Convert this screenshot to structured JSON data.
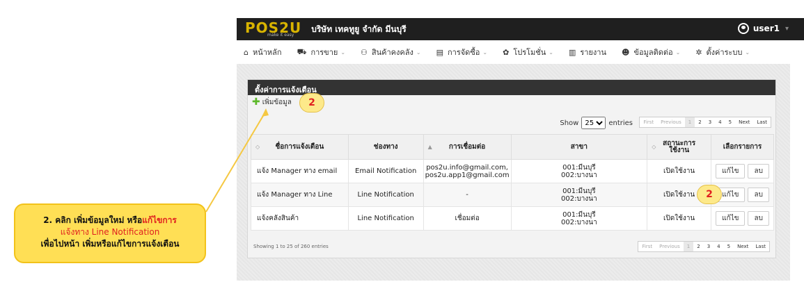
{
  "header": {
    "logo": "POS2U",
    "logo_tagline": "make it easy",
    "company": "บริษัท เทคทูยู จำกัด มีนบุรี",
    "user": "user1"
  },
  "menu": [
    {
      "icon": "home-icon",
      "glyph": "⌂",
      "label": "หน้าหลัก",
      "dropdown": false
    },
    {
      "icon": "cart-icon",
      "glyph": "⛟",
      "label": "การขาย",
      "dropdown": true
    },
    {
      "icon": "stock-icon",
      "glyph": "⚇",
      "label": "สินค้าคงคลัง",
      "dropdown": true
    },
    {
      "icon": "document-icon",
      "glyph": "▤",
      "label": "การจัดซื้อ",
      "dropdown": true
    },
    {
      "icon": "promotion-icon",
      "glyph": "✿",
      "label": "โปรโมชั่น",
      "dropdown": true
    },
    {
      "icon": "report-icon",
      "glyph": "▥",
      "label": "รายงาน",
      "dropdown": false
    },
    {
      "icon": "contacts-icon",
      "glyph": "☻",
      "label": "ข้อมูลติดต่อ",
      "dropdown": true
    },
    {
      "icon": "settings-icon",
      "glyph": "✲",
      "label": "ตั้งค่าระบบ",
      "dropdown": true
    }
  ],
  "panel": {
    "title": "ตั้งค่าการแจ้งเตือน",
    "add_label": "เพิ่มข้อมูล",
    "show_label": "Show",
    "entries_label": "entries",
    "page_size": "25",
    "footer_text": "Showing 1 to 25 of 260 entries"
  },
  "pager": {
    "first": "First",
    "previous": "Previous",
    "pages": [
      "1",
      "2",
      "3",
      "4",
      "5"
    ],
    "next": "Next",
    "last": "Last"
  },
  "table": {
    "headers": [
      "ชื่อการแจ้งเตือน",
      "ช่องทาง",
      "การเชื่อมต่อ",
      "สาขา",
      "สถานะการใช้งาน",
      "เลือกรายการ"
    ],
    "rows": [
      {
        "name": "แจ้ง Manager ทาง email",
        "channel": "Email Notification",
        "connection": "pos2u.info@gmail.com,\npos2u.app1@gmail.com",
        "branch1": "001:มีนบุรี",
        "branch2": "002:บางนา",
        "status": "เปิดใช้งาน"
      },
      {
        "name": "แจ้ง Manager ทาง Line",
        "channel": "Line Notification",
        "connection": "-",
        "branch1": "001:มีนบุรี",
        "branch2": "002:บางนา",
        "status": "เปิดใช้งาน"
      },
      {
        "name": "แจ้งคลังสินค้า",
        "channel": "Line Notification",
        "connection": "เชื่อมต่อ",
        "branch1": "001:มีนบุรี",
        "branch2": "002:บางนา",
        "status": "เปิดใช้งาน"
      }
    ],
    "edit_label": "แก้ไข",
    "delete_label": "ลบ"
  },
  "annotation": {
    "badge": "2",
    "line1_a": "2. คลิก เพิ่มข้อมูลใหม่   หรือ",
    "line1_b": "แก้ไขการ",
    "line2": "แจ้งทาง Line Notification",
    "line3": "เพื่อไปหน้า เพิ่มหรือแก้ไขการแจ้งเตือน"
  },
  "colors": {
    "accent": "#d9b400",
    "header_bg": "#1f1f1f",
    "callout": "#ffdf55",
    "badge_text": "#e02020"
  }
}
